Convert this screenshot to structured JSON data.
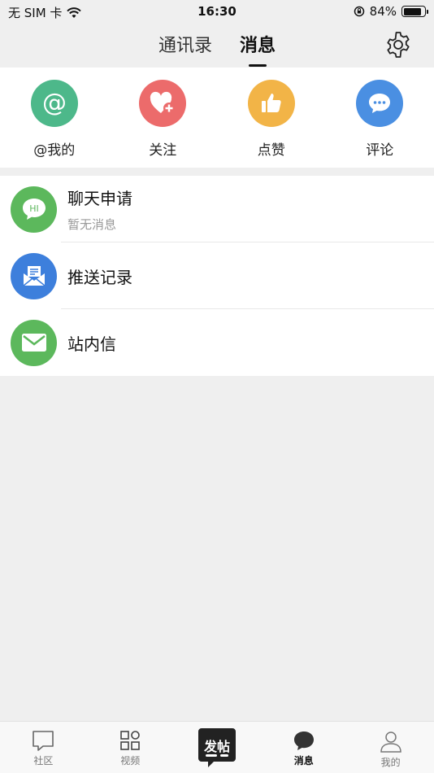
{
  "status": {
    "carrier": "无 SIM 卡",
    "time": "16:30",
    "battery": "84%",
    "battery_level": 0.84
  },
  "header": {
    "tabs": [
      {
        "label": "通讯录"
      },
      {
        "label": "消息"
      }
    ],
    "active_tab": 1
  },
  "quick_actions": [
    {
      "label": "@我的",
      "icon": "at-icon",
      "color": "#4db88a"
    },
    {
      "label": "关注",
      "icon": "heart-plus-icon",
      "color": "#ec6b6b"
    },
    {
      "label": "点赞",
      "icon": "thumbs-up-icon",
      "color": "#f2b447"
    },
    {
      "label": "评论",
      "icon": "comment-icon",
      "color": "#4a8fe2"
    }
  ],
  "list": [
    {
      "title": "聊天申请",
      "subtitle": "暂无消息",
      "icon": "hi-chat-icon",
      "color": "#5cb85c"
    },
    {
      "title": "推送记录",
      "subtitle": "",
      "icon": "push-record-icon",
      "color": "#3d7fdc"
    },
    {
      "title": "站内信",
      "subtitle": "",
      "icon": "mail-icon",
      "color": "#5cb85c"
    }
  ],
  "bottom_nav": {
    "items": [
      {
        "label": "社区",
        "icon": "community-icon"
      },
      {
        "label": "视频",
        "icon": "video-grid-icon"
      },
      {
        "label": "消息",
        "icon": "message-icon"
      },
      {
        "label": "我的",
        "icon": "profile-icon"
      }
    ],
    "post_button": "发帖",
    "active": "消息"
  }
}
